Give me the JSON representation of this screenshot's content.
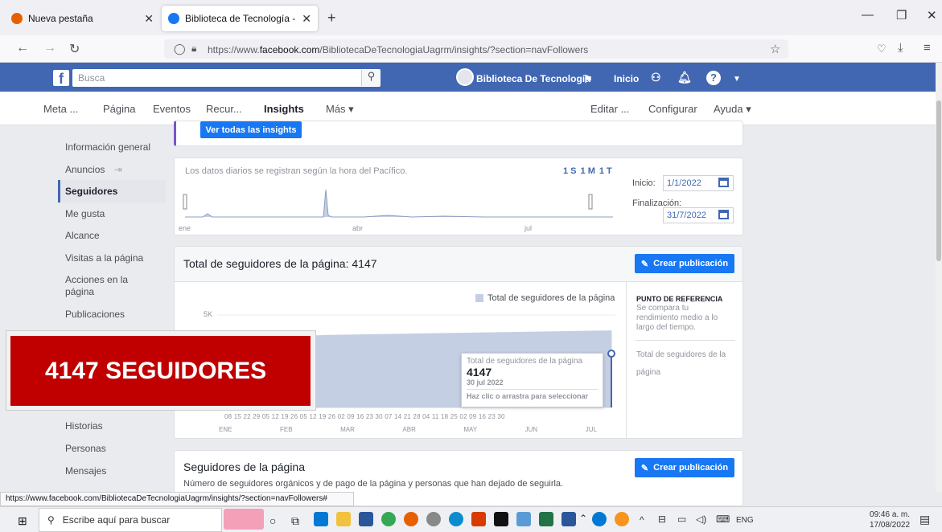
{
  "browser": {
    "tabs": [
      {
        "title": "Nueva pestaña"
      },
      {
        "title": "Biblioteca de Tecnología - Uagr"
      }
    ],
    "new_tab": "+",
    "url_prefix": "https://www.",
    "url_domain": "facebook.com",
    "url_path": "/BibliotecaDeTecnologiaUagrm/insights/?section=navFollowers",
    "status_url": "https://www.facebook.com/BibliotecaDeTecnologiaUagrm/insights/?section=navFollowers#"
  },
  "fb": {
    "search_placeholder": "Busca",
    "page_name": "Biblioteca De Tecnología",
    "home": "Inicio"
  },
  "pagenav": {
    "items": [
      "Meta ...",
      "Página",
      "Eventos",
      "Recur...",
      "Insights",
      "Más ▾"
    ],
    "right": [
      "Editar ...",
      "Configurar",
      "Ayuda ▾"
    ]
  },
  "sidebar": {
    "items": [
      "Información general",
      "Anuncios",
      "Seguidores",
      "Me gusta",
      "Alcance",
      "Visitas a la página",
      "Acciones en la página",
      "Publicaciones",
      "Historias",
      "Personas",
      "Mensajes"
    ]
  },
  "top_card": {
    "button": "Ver todas las insights"
  },
  "range": {
    "note": "Los datos diarios se registran según la hora del Pacífico.",
    "periods": [
      "1 S",
      "1 M",
      "1 T"
    ],
    "start_label": "Inicio:",
    "start": "1/1/2022",
    "end_label": "Finalización:",
    "end": "31/7/2022",
    "months": [
      "ene",
      "abr",
      "jul"
    ]
  },
  "followers_card": {
    "title": "Total de seguidores de la página: 4147",
    "button": "Crear publicación",
    "legend": "Total de seguidores de la página",
    "y_label": "5K",
    "benchmark_title": "PUNTO DE REFERENCIA",
    "benchmark_text": "Se compara tu rendimiento medio a lo largo del tiempo.",
    "benchmark_metric": "Total de seguidores de la página",
    "day_ticks": "08 15 22 29 05 12 19 26 05 12 19 26 02 09 16 23 30 07 14 21 28 04 11 18 25 02 09 16 23 30",
    "month_ticks": [
      "ENE",
      "FEB",
      "MAR",
      "ABR",
      "MAY",
      "JUN",
      "JUL"
    ],
    "tooltip": {
      "title": "Total de seguidores de la página",
      "value": "4147",
      "date": "30 jul 2022",
      "hint": "Haz clic o arrastra para seleccionar"
    }
  },
  "overlay": {
    "text": "4147 SEGUIDORES"
  },
  "page_followers_card": {
    "title": "Seguidores de la página",
    "subtitle": "Número de seguidores orgánicos y de pago de la página y personas que han dejado de seguirla.",
    "button": "Crear publicación"
  },
  "taskbar": {
    "search": "Escribe aquí para buscar",
    "time": "09:46 a. m.",
    "date": "17/08/2022",
    "lang": "ENG"
  },
  "chart_data": {
    "type": "area",
    "title": "Total de seguidores de la página: 4147",
    "ylim": [
      0,
      5000
    ],
    "series": [
      {
        "name": "Total de seguidores de la página",
        "x": [
          "2022-01-01",
          "2022-03-01",
          "2022-07-30"
        ],
        "values": [
          3700,
          3900,
          4147
        ]
      }
    ]
  },
  "colors": {
    "fb_blue": "#4267b2",
    "button_blue": "#1877f2",
    "overlay_red": "#c00000",
    "area_fill": "#c5cfe3"
  }
}
